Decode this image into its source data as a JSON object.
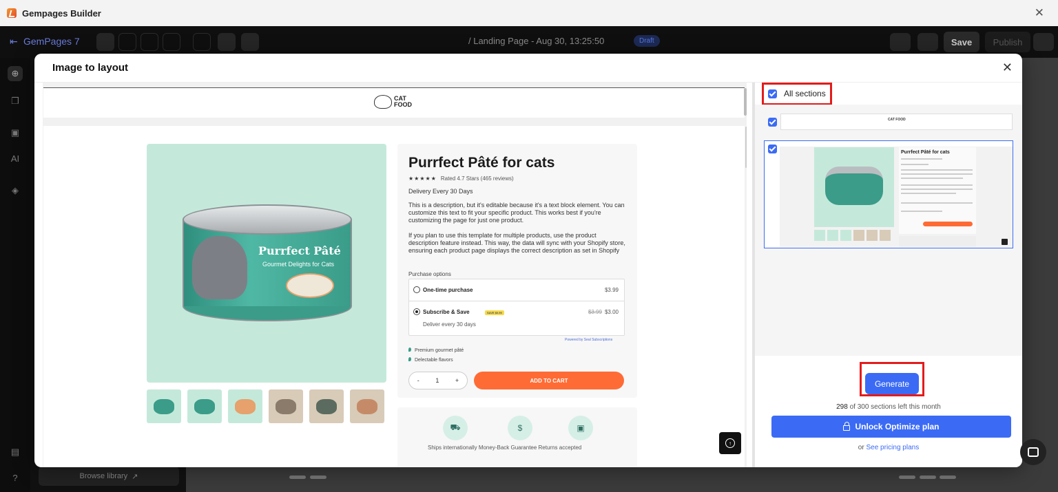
{
  "window": {
    "title": "Gempages Builder",
    "close": "✕"
  },
  "toolbar": {
    "project": "GemPages 7",
    "page": "/ Landing Page - Aug 30, 13:25:50",
    "status": "Draft",
    "save_label": "Save",
    "publish_label": "Publish"
  },
  "sidebar": {
    "browse_library": "Browse library"
  },
  "modal": {
    "title": "Image to layout",
    "close": "✕",
    "preview": {
      "logo_text_1": "CAT",
      "logo_text_2": "FOOD",
      "can_label": "Purrfect Pâté",
      "can_sub": "Gourmet Delights for Cats",
      "product": {
        "title": "Purrfect Pâté for cats",
        "stars": "★★★★★",
        "rating": "Rated 4.7 Stars (465 reviews)",
        "delivery": "Delivery Every 30 Days",
        "desc1": "This is a description, but it's editable because it's a text block element. You can customize this text to fit your specific product. This works best if you're customizing the page for just one product.",
        "desc2": "If you plan to use this template for multiple products, use the product description feature instead. This way, the data will sync with your Shopify store, ensuring each product page displays the correct description as set in Shopify",
        "purchase_options": "Purchase options",
        "option1_name": "One-time purchase",
        "option1_price": "$3.99",
        "option2_name": "Subscribe & Save",
        "option2_badge": "SAVE $0.99",
        "option2_old_price": "$3.99",
        "option2_price": "$3.00",
        "option2_sub": "Deliver every 30 days",
        "powered_by": "Powered by Seal Subscriptions",
        "feature1": "Premium gourmet pâté",
        "feature2": "Delectable flavors",
        "qty_minus": "-",
        "qty_value": "1",
        "qty_plus": "+",
        "add_to_cart": "ADD TO CART"
      },
      "trust_text": "Ships internationally   Money-Back Guarantee   Returns accepted"
    },
    "right": {
      "all_sections_label": "All sections",
      "mini_logo": "CAT FOOD",
      "mini_title": "Purrfect Pâté for cats",
      "generate_label": "Generate",
      "quota_used": "298",
      "quota_rest": "of 300 sections left this month",
      "unlock_label": "Unlock Optimize plan",
      "pricing_prefix": "or",
      "pricing_link": "See pricing plans"
    }
  },
  "colors": {
    "accent": "#3b6bf5",
    "highlight": "#e31b1b",
    "cta": "#ff6b35",
    "mint": "#c4e9da"
  }
}
